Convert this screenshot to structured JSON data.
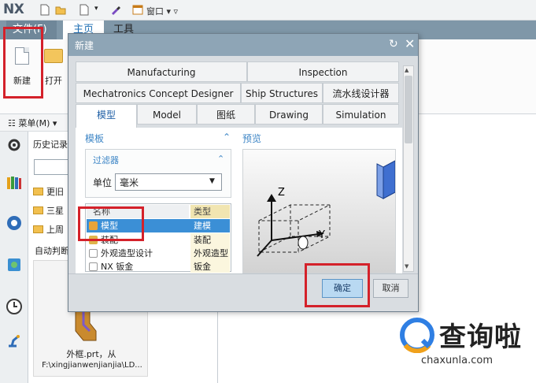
{
  "app": {
    "logo": "NX",
    "window_menu": "窗口 ▾ ▿",
    "ribbon_tabs": [
      "文件(F)",
      "主页",
      "工具"
    ]
  },
  "ribbon": {
    "new_label": "新建",
    "open_label": "打开"
  },
  "menu_bar": {
    "label": "☷ 菜单(M) ▾"
  },
  "history": {
    "title": "历史记录",
    "rows": [
      "更旧",
      "三星",
      "上周"
    ],
    "auto_label": "自动判断",
    "thumb_name": "外框.prt，从",
    "thumb_path": "F:\\xingjianwenjianjia\\LD..."
  },
  "dialog": {
    "title": "新建",
    "tab_rows": {
      "row1": [
        "Manufacturing",
        "Inspection"
      ],
      "row2": [
        "Mechatronics Concept Designer",
        "Ship Structures",
        "流水线设计器"
      ],
      "row3": [
        "模型",
        "Model",
        "图纸",
        "Drawing",
        "Simulation"
      ]
    },
    "active_tab": "模型",
    "templates_heading": "模板",
    "preview_heading": "预览",
    "filter_heading": "过滤器",
    "unit_label": "单位",
    "unit_value": "毫米",
    "table": {
      "columns": [
        "名称",
        "类型"
      ],
      "rows": [
        {
          "name": "模型",
          "type": "建模",
          "selected": true
        },
        {
          "name": "装配",
          "type": "装配"
        },
        {
          "name": "外观造型设计",
          "type": "外观造型"
        },
        {
          "name": "NX 钣金",
          "type": "钣金"
        }
      ]
    },
    "preview_axes": {
      "z": "Z",
      "y": "Y"
    },
    "ok_label": "确定",
    "cancel_label": "取消"
  },
  "watermark": {
    "text": "查询啦",
    "url": "chaxunla.com"
  },
  "colors": {
    "highlight": "#d4212a",
    "accent": "#3b8fd6",
    "titlebar": "#8ea5b6"
  }
}
